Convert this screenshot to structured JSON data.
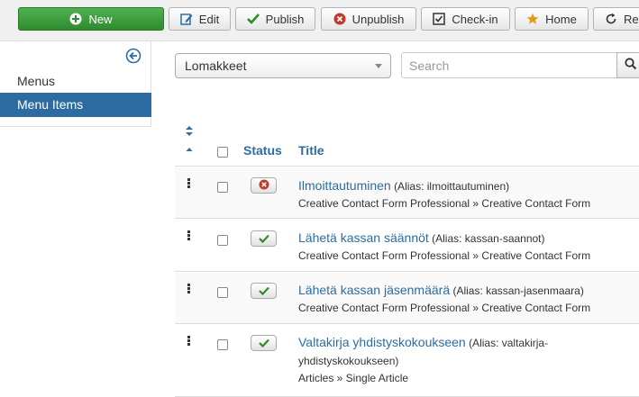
{
  "toolbar": {
    "new_label": "New",
    "edit_label": "Edit",
    "publish_label": "Publish",
    "unpublish_label": "Unpublish",
    "checkin_label": "Check-in",
    "home_label": "Home",
    "rebuild_label": "Rebuild"
  },
  "sidebar": {
    "items": [
      {
        "label": "Menus"
      },
      {
        "label": "Menu Items"
      }
    ]
  },
  "filters": {
    "menu_select": "Lomakkeet",
    "search_placeholder": "Search"
  },
  "table": {
    "headers": {
      "status": "Status",
      "title": "Title"
    },
    "rows": [
      {
        "title": "Ilmoittautuminen",
        "alias": "(Alias: ilmoittautuminen)",
        "type": "Creative Contact Form Professional » Creative Contact Form",
        "status": "unpublished"
      },
      {
        "title": "Lähetä kassan säännöt",
        "alias": "(Alias: kassan-saannot)",
        "type": "Creative Contact Form Professional » Creative Contact Form",
        "status": "published"
      },
      {
        "title": "Lähetä kassan jäsenmäärä",
        "alias": "(Alias: kassan-jasenmaara)",
        "type": "Creative Contact Form Professional » Creative Contact Form",
        "status": "published"
      },
      {
        "title": "Valtakirja yhdistyskokoukseen",
        "alias": "(Alias: valtakirja-yhdistyskokoukseen)",
        "type": "Articles » Single Article",
        "status": "published"
      }
    ]
  },
  "colors": {
    "link": "#2d6ca2",
    "new_button": "#3a9d3a",
    "published": "#2e8b2e",
    "unpublished": "#c0392b"
  },
  "icons": {
    "new": "plus-circle-icon",
    "edit": "edit-icon",
    "publish": "checkmark-icon",
    "unpublish": "x-circle-icon",
    "checkin": "checkbox-icon",
    "home": "star-icon",
    "rebuild": "refresh-icon",
    "sidebar_toggle": "arrow-left-circle-icon",
    "search": "search-icon",
    "sort": "sort-icon",
    "drag": "drag-handle-icon"
  }
}
